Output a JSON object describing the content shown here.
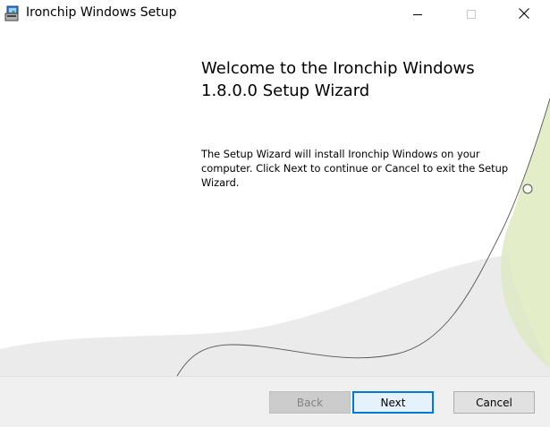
{
  "window": {
    "title": "Ironchip Windows Setup"
  },
  "welcome": {
    "heading_line1": "Welcome to the Ironchip Windows",
    "heading_line2": "1.8.0.0 Setup Wizard",
    "description_line1": "The Setup Wizard will install Ironchip Windows on your",
    "description_line2": "computer. Click Next to continue or Cancel to exit the Setup",
    "description_line3": "Wizard."
  },
  "buttons": {
    "back": "Back",
    "next": "Next",
    "cancel": "Cancel"
  },
  "icons": {
    "app": "installer-icon",
    "minimize": "minimize-icon",
    "maximize": "maximize-icon",
    "close": "close-icon"
  },
  "colors": {
    "accent": "#0078d7",
    "footer_bg": "#f0f0f0",
    "swoosh_gray": "#ebebeb",
    "swoosh_green": "#d6e5b0"
  }
}
